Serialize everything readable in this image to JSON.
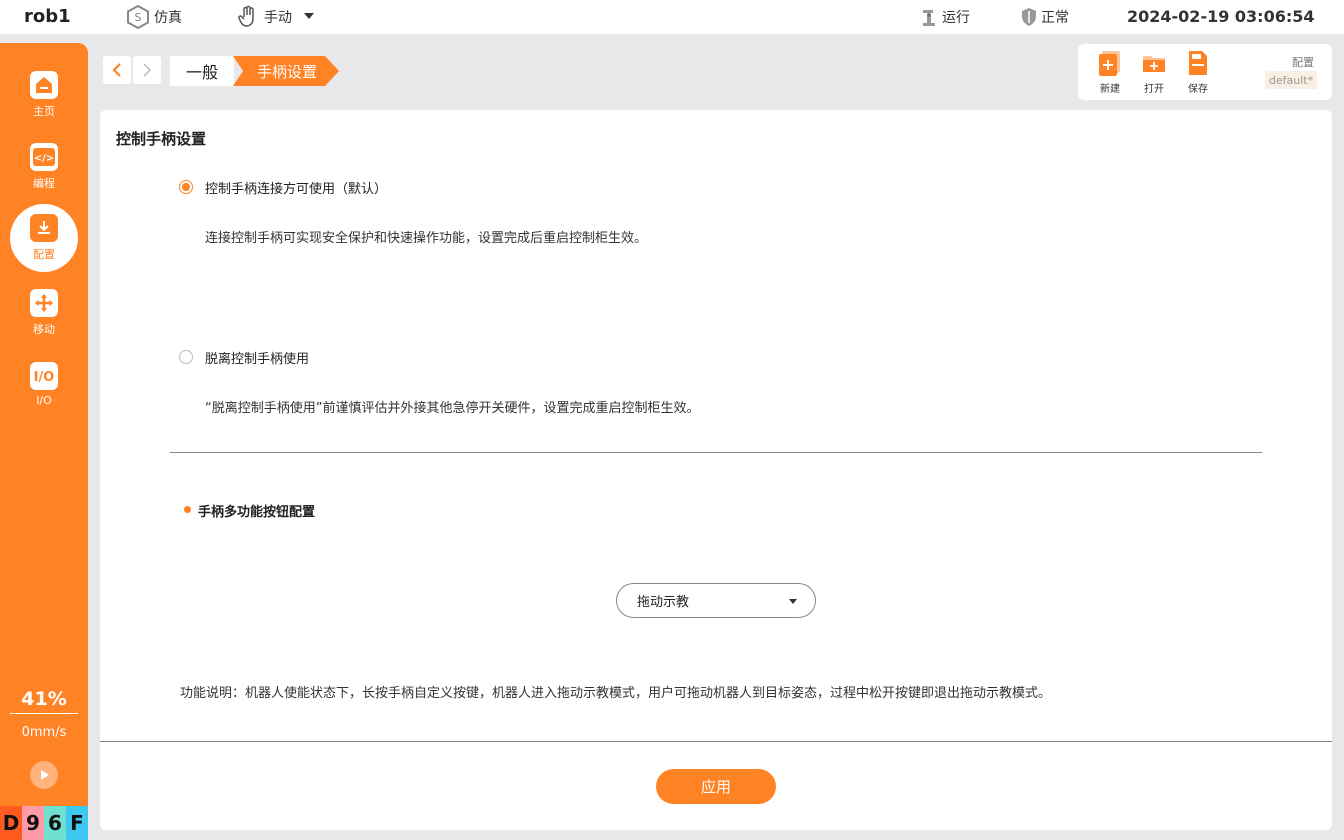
{
  "topbar": {
    "robot_name": "rob1",
    "mode_sim": "仿真",
    "mode_manual": "手动",
    "run_status": "运行",
    "safety_status": "正常",
    "datetime": "2024-02-19 03:06:54"
  },
  "sidebar": {
    "items": [
      {
        "label": "主页",
        "icon": "home-icon"
      },
      {
        "label": "编程",
        "icon": "code-icon"
      },
      {
        "label": "配置",
        "icon": "config-icon"
      },
      {
        "label": "移动",
        "icon": "move-icon"
      },
      {
        "label": "I/O",
        "icon": "io-icon"
      }
    ],
    "speed_percent": "41%",
    "speed_value": "0mm/s",
    "version_chars": [
      "D",
      "9",
      "6",
      "F"
    ]
  },
  "breadcrumb": {
    "items": [
      "一般",
      "手柄设置"
    ]
  },
  "file_panel": {
    "new_label": "新建",
    "open_label": "打开",
    "save_label": "保存",
    "config_label": "配置",
    "config_name": "default*"
  },
  "main": {
    "section_title": "控制手柄设置",
    "option1_label": "控制手柄连接方可使用（默认）",
    "option1_desc": "连接控制手柄可实现安全保护和快速操作功能，设置完成后重启控制柜生效。",
    "option2_label": "脱离控制手柄使用",
    "option2_desc": "“脱离控制手柄使用”前谨慎评估并外接其他急停开关硬件，设置完成重启控制柜生效。",
    "selected_option": 1,
    "sub_title": "手柄多功能按钮配置",
    "select_value": "拖动示教",
    "func_desc": "功能说明：机器人使能状态下，长按手柄自定义按键，机器人进入拖动示教模式，用户可拖动机器人到目标姿态，过程中松开按键即退出拖动示教模式。",
    "apply_label": "应用"
  },
  "colors": {
    "accent": "#ff8224",
    "background": "#e8e8ea",
    "version_bg": [
      "#ff5a1f",
      "#ff9aa6",
      "#6fe0d0",
      "#3cc8f0"
    ]
  }
}
